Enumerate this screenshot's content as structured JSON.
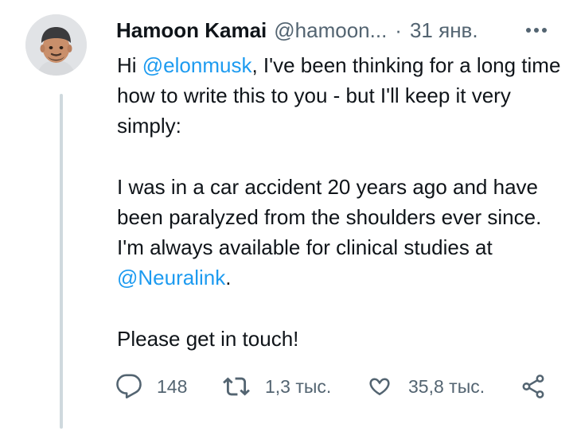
{
  "tweet": {
    "author_name": "Hamoon Kamai",
    "author_handle": "@hamoon...",
    "separator": "·",
    "timestamp": "31 янв.",
    "more_icon": "more-dots-icon",
    "avatar_icon": "memoji-avatar",
    "body": {
      "p1_prefix": "Hi ",
      "p1_mention": "@elonmusk",
      "p1_suffix": ", I've been thinking for a long time how to write this to you - but I'll keep it very simply:",
      "p2_prefix": "I was in a car accident 20 years ago and have been paralyzed from the shoulders ever since. I'm always available for clinical studies at ",
      "p2_mention": "@Neuralink",
      "p2_suffix": ".",
      "p3": "Please get in touch!"
    },
    "actions": {
      "reply_count": "148",
      "retweet_count": "1,3 тыс.",
      "like_count": "35,8 тыс.",
      "reply_icon": "reply-bubble-icon",
      "retweet_icon": "retweet-icon",
      "like_icon": "heart-icon",
      "share_icon": "share-icon"
    },
    "colors": {
      "text": "#0f1419",
      "secondary": "#536471",
      "mention": "#1d9bf0",
      "thread_line": "#cfd9de"
    }
  }
}
